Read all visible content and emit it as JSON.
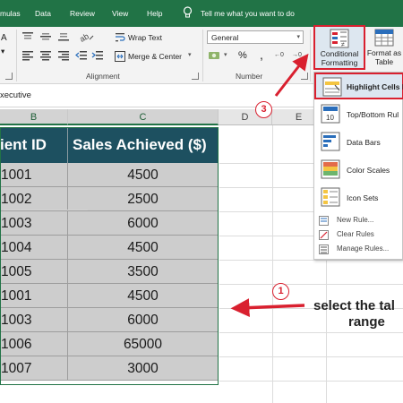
{
  "menu": {
    "items": [
      "mulas",
      "Data",
      "Review",
      "View",
      "Help"
    ],
    "tell_me": "Tell me what you want to do"
  },
  "ribbon": {
    "alignment_label": "Alignment",
    "number_label": "Number",
    "wrap_text": "Wrap Text",
    "merge_center": "Merge & Center",
    "number_format": "General",
    "percent": "%",
    "comma": ",",
    "conditional_formatting": [
      "Conditional",
      "Formatting"
    ],
    "format_as_table": [
      "Format as",
      "Table"
    ]
  },
  "formula_bar": {
    "value": "xecutive"
  },
  "columns": {
    "b": "B",
    "c": "C",
    "d": "D",
    "e": "E"
  },
  "table": {
    "headers": [
      "ient ID",
      "Sales Achieved ($)"
    ],
    "rows": [
      [
        "1001",
        "4500"
      ],
      [
        "1002",
        "2500"
      ],
      [
        "1003",
        "6000"
      ],
      [
        "1004",
        "4500"
      ],
      [
        "1005",
        "3500"
      ],
      [
        "1001",
        "4500"
      ],
      [
        "1003",
        "6000"
      ],
      [
        "1006",
        "65000"
      ],
      [
        "1007",
        "3000"
      ]
    ]
  },
  "dropdown": {
    "items": [
      "Highlight Cells R",
      "Top/Bottom Rul",
      "Data Bars",
      "Color Scales",
      "Icon Sets"
    ],
    "small_items": [
      "New Rule...",
      "Clear Rules",
      "Manage Rules..."
    ],
    "topbottom_icon_text": "10"
  },
  "annotations": {
    "badge_1": "1",
    "badge_3": "3",
    "callout_line1": "select the tal",
    "callout_line2": "range"
  },
  "colors": {
    "accent_green": "#217346",
    "table_header": "#1d5060",
    "highlight_red": "#d9202f",
    "selected_cell": "#cdcdcd"
  }
}
